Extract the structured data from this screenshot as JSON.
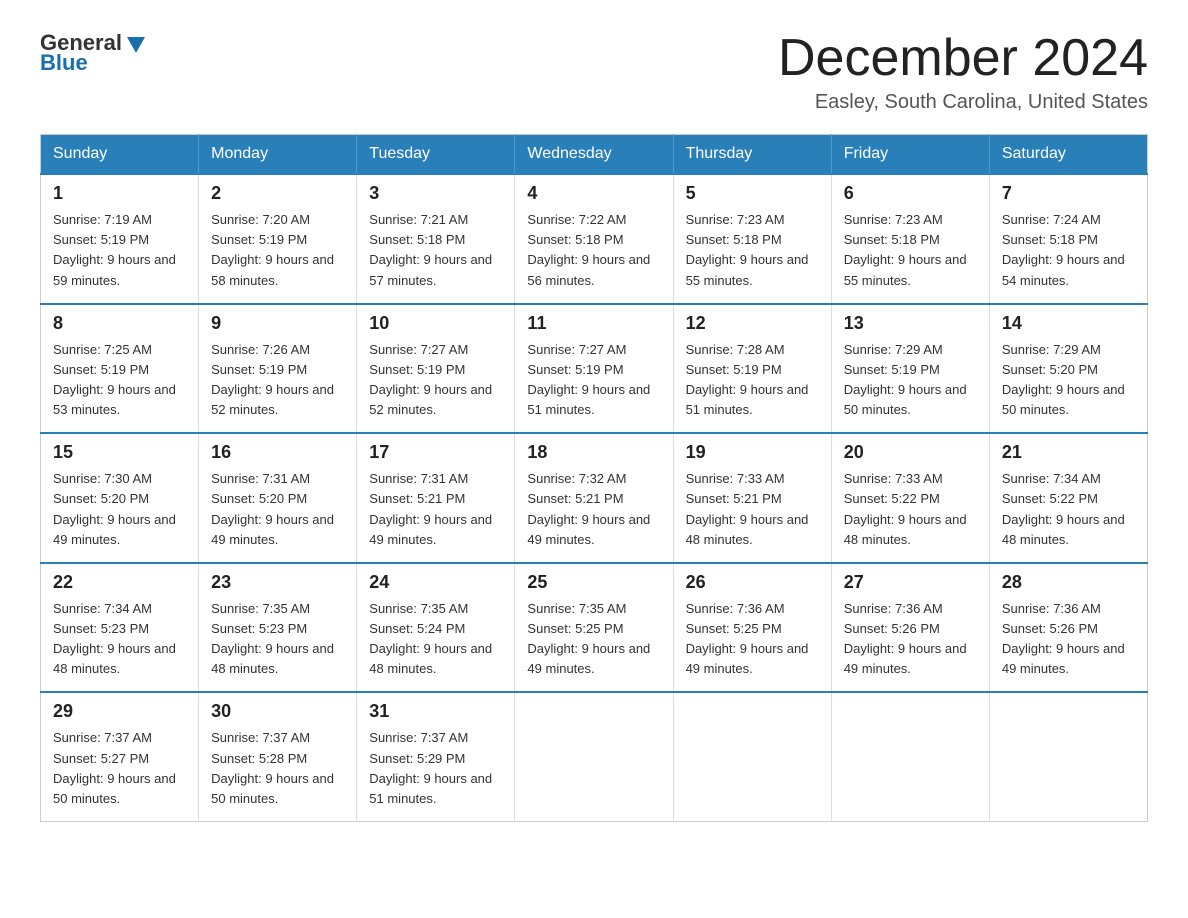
{
  "header": {
    "logo_general": "General",
    "logo_blue": "Blue",
    "month_title": "December 2024",
    "location": "Easley, South Carolina, United States"
  },
  "weekdays": [
    "Sunday",
    "Monday",
    "Tuesday",
    "Wednesday",
    "Thursday",
    "Friday",
    "Saturday"
  ],
  "weeks": [
    [
      {
        "day": "1",
        "sunrise": "7:19 AM",
        "sunset": "5:19 PM",
        "daylight": "9 hours and 59 minutes."
      },
      {
        "day": "2",
        "sunrise": "7:20 AM",
        "sunset": "5:19 PM",
        "daylight": "9 hours and 58 minutes."
      },
      {
        "day": "3",
        "sunrise": "7:21 AM",
        "sunset": "5:18 PM",
        "daylight": "9 hours and 57 minutes."
      },
      {
        "day": "4",
        "sunrise": "7:22 AM",
        "sunset": "5:18 PM",
        "daylight": "9 hours and 56 minutes."
      },
      {
        "day": "5",
        "sunrise": "7:23 AM",
        "sunset": "5:18 PM",
        "daylight": "9 hours and 55 minutes."
      },
      {
        "day": "6",
        "sunrise": "7:23 AM",
        "sunset": "5:18 PM",
        "daylight": "9 hours and 55 minutes."
      },
      {
        "day": "7",
        "sunrise": "7:24 AM",
        "sunset": "5:18 PM",
        "daylight": "9 hours and 54 minutes."
      }
    ],
    [
      {
        "day": "8",
        "sunrise": "7:25 AM",
        "sunset": "5:19 PM",
        "daylight": "9 hours and 53 minutes."
      },
      {
        "day": "9",
        "sunrise": "7:26 AM",
        "sunset": "5:19 PM",
        "daylight": "9 hours and 52 minutes."
      },
      {
        "day": "10",
        "sunrise": "7:27 AM",
        "sunset": "5:19 PM",
        "daylight": "9 hours and 52 minutes."
      },
      {
        "day": "11",
        "sunrise": "7:27 AM",
        "sunset": "5:19 PM",
        "daylight": "9 hours and 51 minutes."
      },
      {
        "day": "12",
        "sunrise": "7:28 AM",
        "sunset": "5:19 PM",
        "daylight": "9 hours and 51 minutes."
      },
      {
        "day": "13",
        "sunrise": "7:29 AM",
        "sunset": "5:19 PM",
        "daylight": "9 hours and 50 minutes."
      },
      {
        "day": "14",
        "sunrise": "7:29 AM",
        "sunset": "5:20 PM",
        "daylight": "9 hours and 50 minutes."
      }
    ],
    [
      {
        "day": "15",
        "sunrise": "7:30 AM",
        "sunset": "5:20 PM",
        "daylight": "9 hours and 49 minutes."
      },
      {
        "day": "16",
        "sunrise": "7:31 AM",
        "sunset": "5:20 PM",
        "daylight": "9 hours and 49 minutes."
      },
      {
        "day": "17",
        "sunrise": "7:31 AM",
        "sunset": "5:21 PM",
        "daylight": "9 hours and 49 minutes."
      },
      {
        "day": "18",
        "sunrise": "7:32 AM",
        "sunset": "5:21 PM",
        "daylight": "9 hours and 49 minutes."
      },
      {
        "day": "19",
        "sunrise": "7:33 AM",
        "sunset": "5:21 PM",
        "daylight": "9 hours and 48 minutes."
      },
      {
        "day": "20",
        "sunrise": "7:33 AM",
        "sunset": "5:22 PM",
        "daylight": "9 hours and 48 minutes."
      },
      {
        "day": "21",
        "sunrise": "7:34 AM",
        "sunset": "5:22 PM",
        "daylight": "9 hours and 48 minutes."
      }
    ],
    [
      {
        "day": "22",
        "sunrise": "7:34 AM",
        "sunset": "5:23 PM",
        "daylight": "9 hours and 48 minutes."
      },
      {
        "day": "23",
        "sunrise": "7:35 AM",
        "sunset": "5:23 PM",
        "daylight": "9 hours and 48 minutes."
      },
      {
        "day": "24",
        "sunrise": "7:35 AM",
        "sunset": "5:24 PM",
        "daylight": "9 hours and 48 minutes."
      },
      {
        "day": "25",
        "sunrise": "7:35 AM",
        "sunset": "5:25 PM",
        "daylight": "9 hours and 49 minutes."
      },
      {
        "day": "26",
        "sunrise": "7:36 AM",
        "sunset": "5:25 PM",
        "daylight": "9 hours and 49 minutes."
      },
      {
        "day": "27",
        "sunrise": "7:36 AM",
        "sunset": "5:26 PM",
        "daylight": "9 hours and 49 minutes."
      },
      {
        "day": "28",
        "sunrise": "7:36 AM",
        "sunset": "5:26 PM",
        "daylight": "9 hours and 49 minutes."
      }
    ],
    [
      {
        "day": "29",
        "sunrise": "7:37 AM",
        "sunset": "5:27 PM",
        "daylight": "9 hours and 50 minutes."
      },
      {
        "day": "30",
        "sunrise": "7:37 AM",
        "sunset": "5:28 PM",
        "daylight": "9 hours and 50 minutes."
      },
      {
        "day": "31",
        "sunrise": "7:37 AM",
        "sunset": "5:29 PM",
        "daylight": "9 hours and 51 minutes."
      },
      null,
      null,
      null,
      null
    ]
  ],
  "labels": {
    "sunrise": "Sunrise:",
    "sunset": "Sunset:",
    "daylight": "Daylight:"
  }
}
